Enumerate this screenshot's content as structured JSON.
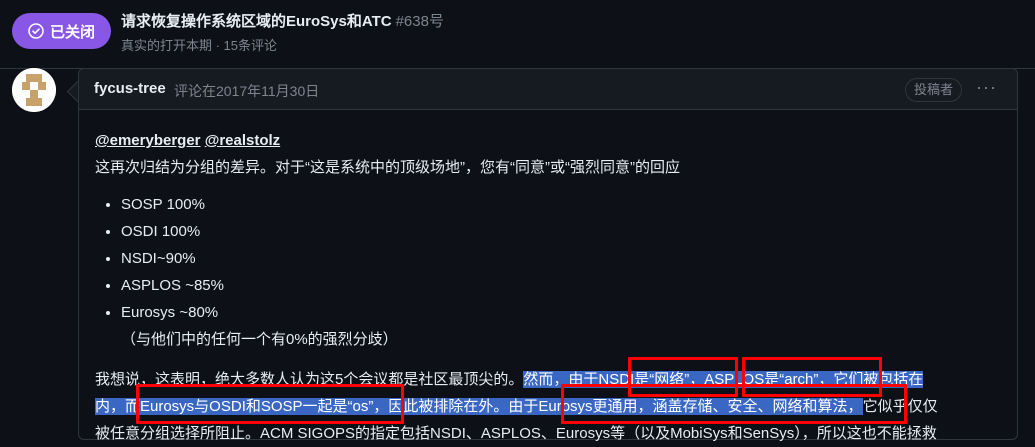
{
  "issue": {
    "state": "已关闭",
    "title": "请求恢复操作系统区域的EuroSys和ATC",
    "number": "#638号",
    "subtitle": "真实的打开本期 · 15条评论"
  },
  "comment": {
    "author": "fycus-tree",
    "when": "评论在2017年11月30日",
    "role": "投稿者",
    "more_label": "···",
    "mentions": [
      "@emeryberger",
      "@realstolz"
    ],
    "intro": "这再次归结为分组的差异。对于“这是系统中的顶级场地”，您有“同意”或“强烈同意”的回应",
    "items": [
      "SOSP 100%",
      "OSDI 100%",
      "NSDI~90%",
      "ASPLOS ~85%",
      "Eurosys ~80%"
    ],
    "items_note": "（与他们中的任何一个有0%的强烈分歧）",
    "para_line1_plain": "我想说，这表明，绝大多数人认为这5个会议都是社区最顶尖的。",
    "para_line1_hl": "然而，由于NSDI是“网络”，ASPLOS是“arch”，它们被包括在",
    "para_line2_hl": "内，而Eurosys与OSDI和SOSP一起是“os”，因此被排除在外。由于Eurosys更通用，涵盖存储、安全、网络和算法，",
    "para_line2_plain": "它似乎仅仅",
    "para_line3": "被任意分组选择所阻止。ACM SIGOPS的指定包括NSDI、ASPLOS、Eurosys等（以及MobiSys和SenSys），所以这也不能拯救"
  },
  "colors": {
    "closed_purple": "#8957e5",
    "selection_blue": "#3b67c4",
    "annotation_red": "#ff0000"
  }
}
